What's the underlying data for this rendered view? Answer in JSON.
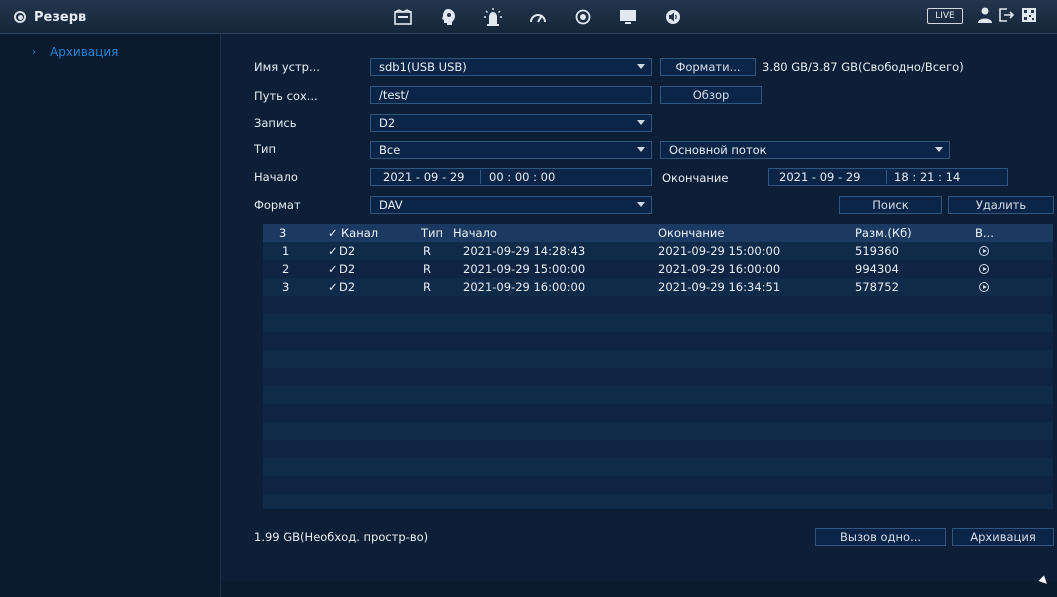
{
  "topbar": {
    "title": "Резерв",
    "live_label": "LIVE",
    "icons": [
      "storage-icon",
      "face-icon",
      "alarm-icon",
      "gauge-icon",
      "record-icon",
      "monitor-icon",
      "audio-icon"
    ]
  },
  "sidebar": {
    "items": [
      {
        "label": "Архивация"
      }
    ]
  },
  "form": {
    "device_label": "Имя устр...",
    "device_value": "sdb1(USB USB)",
    "format_button": "Формати...",
    "capacity_text": "3.80 GB/3.87 GB(Свободно/Всего)",
    "path_label": "Путь сох...",
    "path_value": "/test/",
    "browse_button": "Обзор",
    "record_label": "Запись",
    "record_value": "D2",
    "type_label": "Тип",
    "type_value": "Все",
    "stream_value": "Основной поток",
    "start_label": "Начало",
    "start_date": "2021 - 09 - 29",
    "start_time": "00 : 00 : 00",
    "end_label": "Окончание",
    "end_date": "2021 - 09 - 29",
    "end_time": "18 : 21 : 14",
    "format_label": "Формат",
    "format_value": "DAV",
    "search_button": "Поиск",
    "delete_button": "Удалить"
  },
  "table": {
    "headers": {
      "count": "3",
      "channel": "Канал",
      "type": "Тип",
      "start": "Начало",
      "end": "Окончание",
      "size": "Разм.(Кб)",
      "play": "В..."
    },
    "rows": [
      {
        "num": "1",
        "channel": "D2",
        "type": "R",
        "start": "2021-09-29 14:28:43",
        "end": "2021-09-29 15:00:00",
        "size": "519360"
      },
      {
        "num": "2",
        "channel": "D2",
        "type": "R",
        "start": "2021-09-29 15:00:00",
        "end": "2021-09-29 16:00:00",
        "size": "994304"
      },
      {
        "num": "3",
        "channel": "D2",
        "type": "R",
        "start": "2021-09-29 16:00:00",
        "end": "2021-09-29 16:34:51",
        "size": "578752"
      }
    ]
  },
  "footer": {
    "required_space": "1.99 GB(Необход. простр-во)",
    "eject_button": "Вызов одно...",
    "backup_button": "Архивация"
  },
  "colors": {
    "accent": "#1e84d8",
    "background": "#0c1f37",
    "field_bg": "#0a2547",
    "field_border": "#2f567f"
  }
}
